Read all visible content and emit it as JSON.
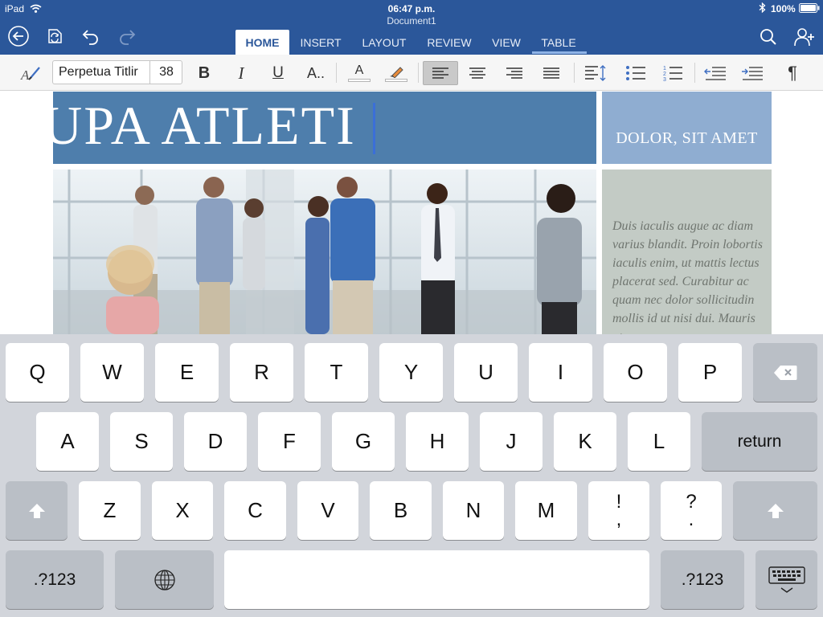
{
  "status": {
    "device": "iPad",
    "time": "06:47 p.m.",
    "document_name": "Document1",
    "battery": "100%"
  },
  "tabs": [
    {
      "label": "HOME"
    },
    {
      "label": "INSERT"
    },
    {
      "label": "LAYOUT"
    },
    {
      "label": "REVIEW"
    },
    {
      "label": "VIEW"
    },
    {
      "label": "TABLE"
    }
  ],
  "ribbon": {
    "font_name": "Perpetua Titlir",
    "font_size": "38",
    "bold_label": "B",
    "italic_label": "I",
    "underline_label": "U",
    "format_label": "A..",
    "font_color_label": "A",
    "pilcrow": "¶"
  },
  "document": {
    "title": "AUPA ATLETI",
    "side_title": "DOLOR, SIT AMET",
    "side_body": "Duis iaculis augue ac diam varius blandit. Proin lobortis iaculis enim, ut mattis lectus placerat sed. Curabitur ac quam nec dolor sollicitudin mollis id ut nisi dui. Mauris ut"
  },
  "keyboard": {
    "row1": [
      "Q",
      "W",
      "E",
      "R",
      "T",
      "Y",
      "U",
      "I",
      "O",
      "P"
    ],
    "row2": [
      "A",
      "S",
      "D",
      "F",
      "G",
      "H",
      "J",
      "K",
      "L"
    ],
    "return_label": "return",
    "row3": [
      "Z",
      "X",
      "C",
      "V",
      "B",
      "N",
      "M"
    ],
    "punct1": {
      "top": "!",
      "bottom": ","
    },
    "punct2": {
      "top": "?",
      "bottom": "."
    },
    "numbers_label": ".?123"
  },
  "colors": {
    "header_blue": "#2b579a",
    "title_banner": "#4e7eac",
    "side_banner": "#8fadd1",
    "side_box": "#c3cbc5"
  }
}
